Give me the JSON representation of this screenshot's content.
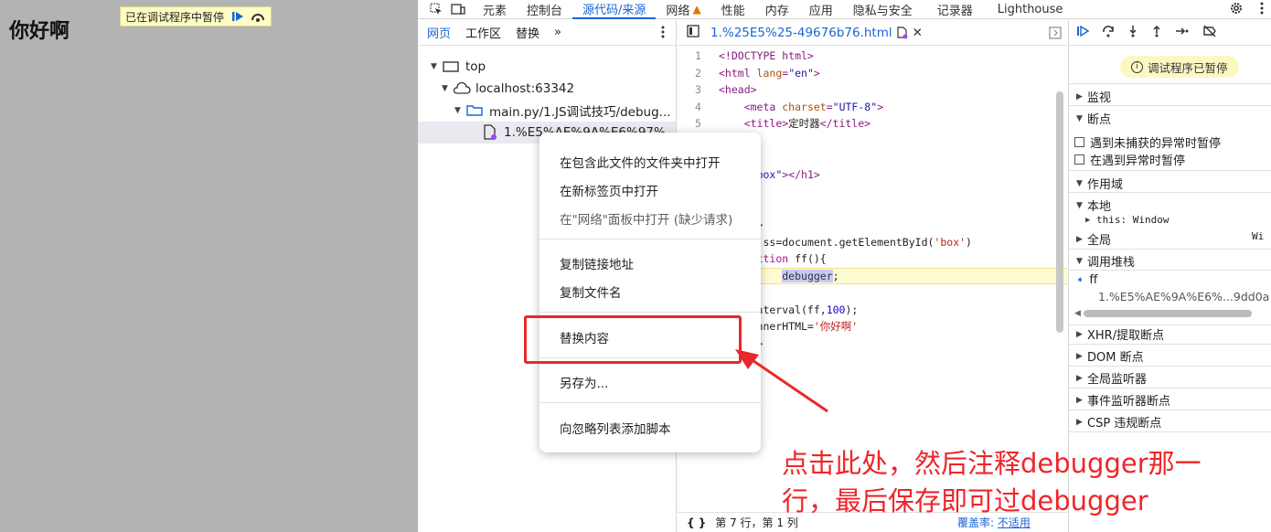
{
  "page": {
    "heading": "你好啊",
    "paused_banner": "已在调试程序中暂停"
  },
  "devtools": {
    "top_tabs": [
      "元素",
      "控制台",
      "源代码/来源",
      "网络",
      "性能",
      "内存",
      "应用",
      "隐私与安全",
      "记录器",
      "Lighthouse"
    ],
    "active_top_tab": "源代码/来源",
    "navigator": {
      "tabs": [
        "网页",
        "工作区",
        "替换",
        "»"
      ],
      "tree": {
        "top": "top",
        "host": "localhost:63342",
        "folder": "main.py/1.JS调试技巧/debug...",
        "file": "1.%E5%AE%9A%E6%97%"
      }
    },
    "editor": {
      "file_tab": "1.%25E5%25-49676b76.html",
      "lines": [
        {
          "n": "1",
          "parts": [
            [
              "tag",
              "<!DOCTYPE html>"
            ]
          ]
        },
        {
          "n": "2",
          "parts": [
            [
              "tag",
              "<html "
            ],
            [
              "attr",
              "lang"
            ],
            [
              "tag",
              "="
            ],
            [
              "val",
              "\"en\""
            ],
            [
              "tag",
              ">"
            ]
          ]
        },
        {
          "n": "3",
          "parts": [
            [
              "tag",
              "<head>"
            ]
          ]
        },
        {
          "n": "4",
          "parts": [
            [
              "txt",
              "    "
            ],
            [
              "tag",
              "<meta "
            ],
            [
              "attr",
              "charset"
            ],
            [
              "tag",
              "="
            ],
            [
              "val",
              "\"UTF-8\""
            ],
            [
              "tag",
              ">"
            ]
          ]
        },
        {
          "n": "5",
          "parts": [
            [
              "txt",
              "    "
            ],
            [
              "tag",
              "<title>"
            ],
            [
              "txt",
              "定时器"
            ],
            [
              "tag",
              "</title>"
            ]
          ]
        },
        {
          "n": "",
          "parts": [
            [
              "txt",
              "  "
            ],
            [
              "tag",
              "ead>"
            ]
          ]
        },
        {
          "n": "",
          "parts": [
            [
              "txt",
              ""
            ]
          ]
        },
        {
          "n": "",
          "parts": [
            [
              "txt",
              "  "
            ],
            [
              "attr",
              "id"
            ],
            [
              "tag",
              "="
            ],
            [
              "val",
              "\"box\""
            ],
            [
              "tag",
              "></h1>"
            ]
          ]
        },
        {
          "n": "",
          "parts": [
            [
              "txt",
              ""
            ]
          ]
        },
        {
          "n": "",
          "parts": [
            [
              "txt",
              "  "
            ],
            [
              "tag",
              "dy>"
            ]
          ]
        },
        {
          "n": "",
          "parts": [
            [
              "txt",
              "  "
            ],
            [
              "tag",
              "ript>"
            ]
          ]
        },
        {
          "n": "",
          "parts": [
            [
              "txt",
              "   "
            ],
            [
              "kw",
              "var "
            ],
            [
              "txt",
              "ss=document.getElementById("
            ],
            [
              "str",
              "'box'"
            ],
            [
              "txt",
              ")"
            ]
          ]
        },
        {
          "n": "",
          "parts": [
            [
              "txt",
              "   "
            ],
            [
              "kw",
              "function "
            ],
            [
              "txt",
              "ff(){"
            ]
          ],
          "hl": false
        },
        {
          "n": "",
          "parts": [
            [
              "txt",
              "          "
            ],
            [
              "dbg",
              "debugger"
            ],
            [
              "txt",
              ";"
            ]
          ],
          "hl": true
        },
        {
          "n": "",
          "parts": [
            [
              "txt",
              "   }"
            ]
          ]
        },
        {
          "n": "",
          "parts": [
            [
              "txt",
              "  setInterval(ff,"
            ],
            [
              "num",
              "100"
            ],
            [
              "txt",
              ");"
            ]
          ]
        },
        {
          "n": "",
          "parts": [
            [
              "txt",
              "  ss.innerHTML="
            ],
            [
              "str",
              "'你好啊'"
            ]
          ]
        },
        {
          "n": "",
          "parts": [
            [
              "txt",
              "  "
            ],
            [
              "tag",
              "ript>"
            ]
          ]
        },
        {
          "n": "",
          "parts": [
            [
              "txt",
              ""
            ]
          ]
        },
        {
          "n": "",
          "parts": [
            [
              "txt",
              "  "
            ],
            [
              "tag",
              "dy>"
            ]
          ]
        },
        {
          "n": "",
          "parts": [
            [
              "txt",
              "  "
            ],
            [
              "tag",
              "ml>"
            ]
          ]
        }
      ],
      "status_left": "第 7 行，第 1 列",
      "status_coverage_label": "覆盖率:",
      "status_coverage_value": "不适用"
    },
    "sidebar": {
      "paused_pill": "调试程序已暂停",
      "watch": "监视",
      "breakpoints": "断点",
      "cb_uncaught": "遇到未捕获的异常时暂停",
      "cb_caught": "在遇到异常时暂停",
      "scope": "作用域",
      "local": "本地",
      "this_line": "this: Window",
      "global": "全局",
      "global_value": "Wi",
      "call_stack": "调用堆栈",
      "frame_name": "ff",
      "frame_location": "1.%E5%AE%9A%E6%...9dd0a",
      "xhr": "XHR/提取断点",
      "dom": "DOM 断点",
      "global_listeners": "全局监听器",
      "event_listeners": "事件监听器断点",
      "csp": "CSP 违规断点"
    }
  },
  "context_menu": {
    "items": [
      {
        "label": "在包含此文件的文件夹中打开",
        "enabled": true
      },
      {
        "label": "在新标签页中打开",
        "enabled": true
      },
      {
        "label": "在\"网络\"面板中打开 (缺少请求)",
        "enabled": false
      },
      {
        "label": "复制链接地址",
        "enabled": true
      },
      {
        "label": "复制文件名",
        "enabled": true
      },
      {
        "label": "替换内容",
        "enabled": true
      },
      {
        "label": "另存为...",
        "enabled": true
      },
      {
        "label": "向忽略列表添加脚本",
        "enabled": true
      }
    ]
  },
  "annotation": {
    "line1": "点击此处，然后注释debugger那一",
    "line2": "行，最后保存即可过debugger",
    "color": "#f0252a"
  }
}
